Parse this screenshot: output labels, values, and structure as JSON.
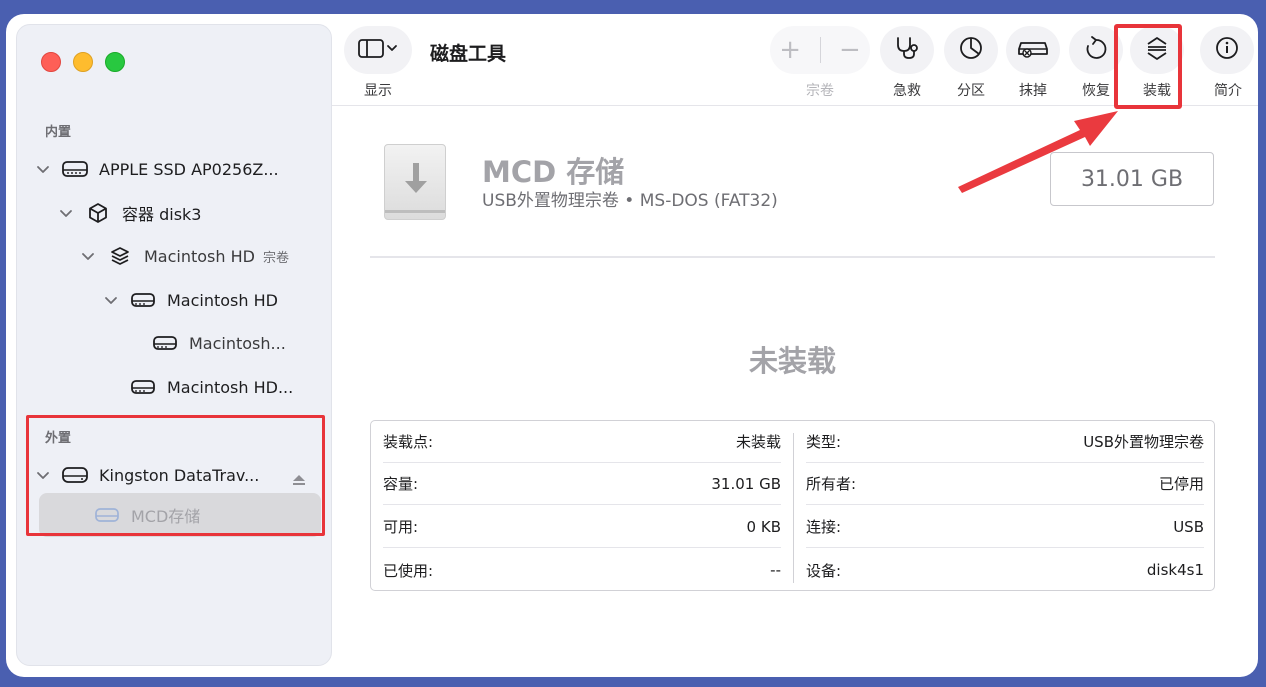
{
  "sidebar": {
    "internal_label": "内置",
    "external_label": "外置",
    "items": [
      {
        "label": "APPLE SSD AP0256Z...",
        "sub": ""
      },
      {
        "label": "容器 disk3",
        "sub": ""
      },
      {
        "label": "Macintosh HD",
        "sub": "宗卷"
      },
      {
        "label": "Macintosh HD",
        "sub": ""
      },
      {
        "label": "Macintosh...",
        "sub": ""
      },
      {
        "label": "Macintosh HD...",
        "sub": ""
      },
      {
        "label": "Kingston DataTrav...",
        "sub": ""
      },
      {
        "label": "MCD存储",
        "sub": ""
      }
    ]
  },
  "toolbar": {
    "title": "磁盘工具",
    "view_label": "显示",
    "volume_label": "宗卷",
    "firstaid_label": "急救",
    "partition_label": "分区",
    "erase_label": "抹掉",
    "restore_label": "恢复",
    "mount_label": "装载",
    "info_label": "简介"
  },
  "volume": {
    "name": "MCD 存储",
    "description": "USB外置物理宗卷 • MS-DOS (FAT32)",
    "size": "31.01 GB",
    "status": "未装载"
  },
  "details": {
    "left": [
      {
        "key": "装载点:",
        "value": "未装载"
      },
      {
        "key": "容量:",
        "value": "31.01 GB"
      },
      {
        "key": "可用:",
        "value": "0 KB"
      },
      {
        "key": "已使用:",
        "value": "--"
      }
    ],
    "right": [
      {
        "key": "类型:",
        "value": "USB外置物理宗卷"
      },
      {
        "key": "所有者:",
        "value": "已停用"
      },
      {
        "key": "连接:",
        "value": "USB"
      },
      {
        "key": "设备:",
        "value": "disk4s1"
      }
    ]
  },
  "colors": {
    "highlight": "#e8343a",
    "background": "#4a5fb0",
    "selection": "#d9d9dc"
  }
}
